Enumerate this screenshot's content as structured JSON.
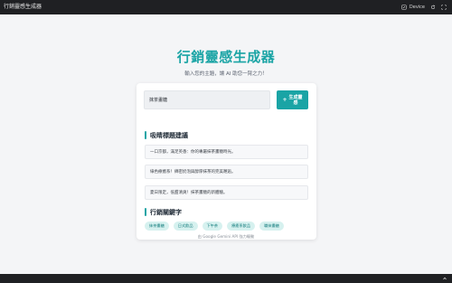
{
  "window": {
    "title": "行銷靈感生成器",
    "device_label": "Device"
  },
  "header": {
    "title": "行銷靈感生成器",
    "subtitle": "輸入您的主題，讓 AI 助您一臂之力！"
  },
  "form": {
    "input_value": "抹茶畫糖",
    "button_label": "生成靈感",
    "button_icon": "plus-icon"
  },
  "suggestions": {
    "heading": "吸睛標題建議",
    "items": [
      "一口京都，滿足英香：你的專屬抹茶畫糖時光。",
      "綠色療癒系！綿密奶泡與醇厚抹茶的完美邂逅。",
      "夏日限定，低甜清爽！抹茶畫糖的新體驗。"
    ]
  },
  "keywords": {
    "heading": "行銷關鍵字",
    "items": [
      "抹茶畫糖",
      "日式飲品",
      "下午茶",
      "療癒系飲品",
      "職抹畫糖"
    ]
  },
  "footer": {
    "text": "由 Google Gemini API 強力驅動"
  },
  "colors": {
    "accent": "#1aa4a5",
    "tag_bg": "#d6f1ef",
    "page_bg": "#f4f5f7"
  }
}
